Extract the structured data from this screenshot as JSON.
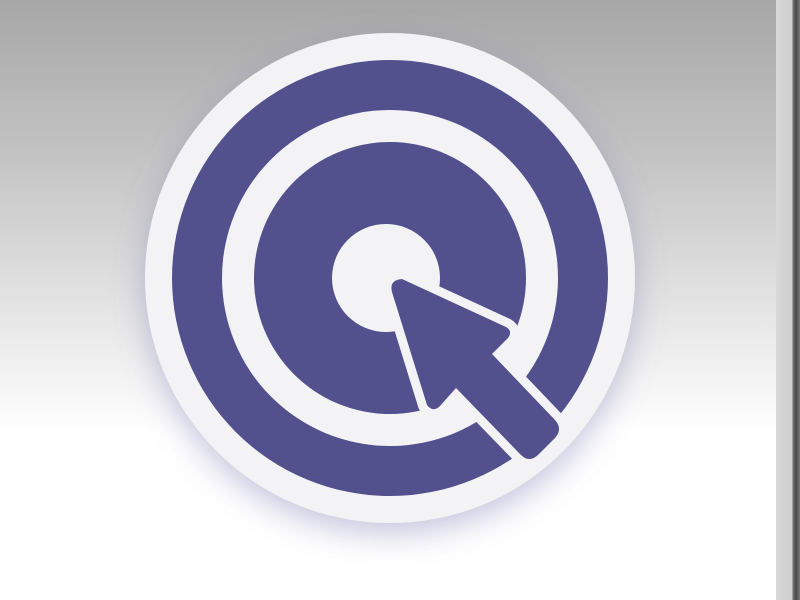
{
  "icon": {
    "name": "target-cursor-icon",
    "colors": {
      "primary": "#52508d",
      "light": "#f3f3f5",
      "shadow": "#7a78b0"
    }
  }
}
